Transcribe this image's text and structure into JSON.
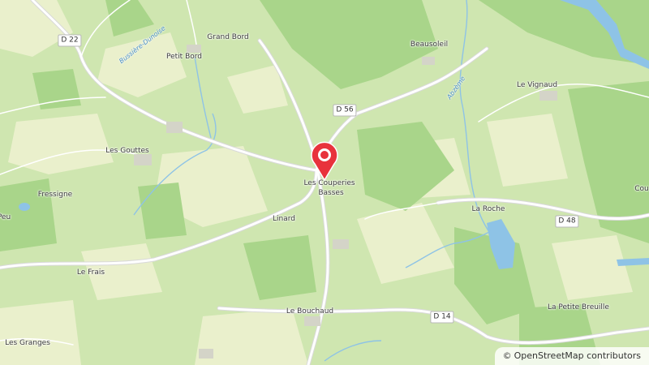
{
  "map": {
    "places": [
      {
        "id": "grand-bord",
        "label": "Grand Bord"
      },
      {
        "id": "petit-bord",
        "label": "Petit Bord"
      },
      {
        "id": "beausoleil",
        "label": "Beausoleil"
      },
      {
        "id": "le-vignaud",
        "label": "Le Vignaud"
      },
      {
        "id": "les-gouttes",
        "label": "Les Gouttes"
      },
      {
        "id": "fressigne",
        "label": "Fressigne"
      },
      {
        "id": "peu",
        "label": "Peu"
      },
      {
        "id": "les-couperies",
        "label": "Les Couperies"
      },
      {
        "id": "basses",
        "label": "Basses"
      },
      {
        "id": "linard",
        "label": "Linard"
      },
      {
        "id": "la-roche",
        "label": "La Roche"
      },
      {
        "id": "le-frais",
        "label": "Le Frais"
      },
      {
        "id": "le-bouchaud",
        "label": "Le Bouchaud"
      },
      {
        "id": "la-petite-breuille",
        "label": "La Petite Breuille"
      },
      {
        "id": "les-granges",
        "label": "Les Granges"
      },
      {
        "id": "cou",
        "label": "Cou"
      }
    ],
    "roads": [
      "D 22",
      "D 56",
      "D 48",
      "D 14"
    ],
    "water_labels": [
      "Bussière-Dunoise",
      "Abzème"
    ],
    "marker": {
      "type": "location-pin",
      "color": "#e8323c"
    },
    "colors": {
      "meadow": "#cfe6b0",
      "forest": "#a9d58a",
      "farmland": "#eaf0cc",
      "water": "#8ec3e6",
      "road": "#ffffff"
    }
  },
  "attribution": {
    "symbol": "©",
    "text": "OpenStreetMap contributors"
  }
}
